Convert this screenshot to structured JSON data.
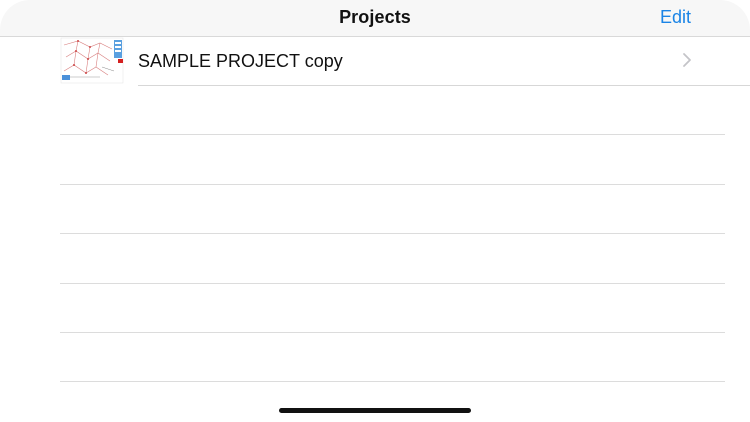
{
  "navbar": {
    "title": "Projects",
    "edit_label": "Edit"
  },
  "projects": [
    {
      "name": "SAMPLE PROJECT copy"
    }
  ],
  "colors": {
    "accent": "#1a84e6",
    "navbar_bg": "#f7f7f7",
    "separator": "#dcdcdc"
  },
  "icons": {
    "row_accessory": "chevron-right-icon",
    "thumbnail": "project-thumbnail"
  }
}
